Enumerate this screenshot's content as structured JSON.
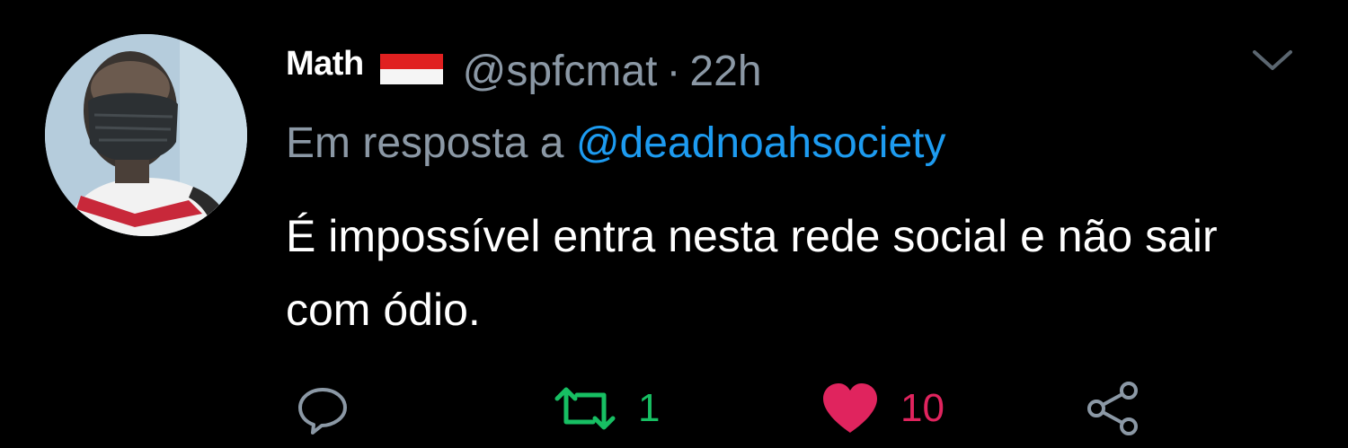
{
  "tweet": {
    "display_name": "Math",
    "handle": "@spfcmat",
    "separator": "·",
    "time": "22h",
    "reply_prefix": "Em resposta a",
    "reply_to": "@deadnoahsociety",
    "text": "É impossível entra nesta rede social e não sair com ódio."
  },
  "actions": {
    "retweet_count": "1",
    "like_count": "10"
  },
  "icons": {
    "flag": "flag-icon",
    "menu": "chevron-down-icon",
    "reply": "reply-icon",
    "retweet": "retweet-icon",
    "like": "heart-icon",
    "share": "share-icon"
  },
  "colors": {
    "background": "#000000",
    "text": "#ffffff",
    "muted": "#8b98a5",
    "link": "#1d9bf0",
    "retweet_active": "#17bf63",
    "like_active": "#e0245e"
  }
}
